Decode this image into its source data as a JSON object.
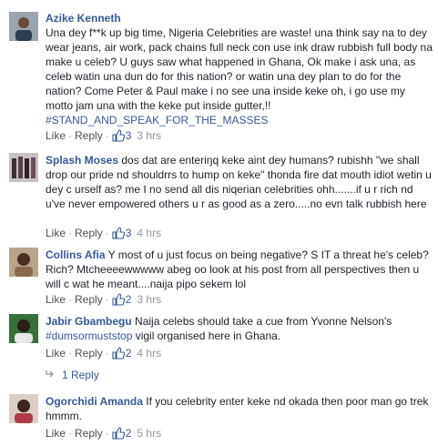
{
  "comments": [
    {
      "author": "Azike Kenneth",
      "text": "Una dey f**k up big time, Nigeria Celebrities are waste! una think say na to dey wear jeans, air work, pack chains full neck con use ink draw rubbish full body na make u celeb? U guys saw what happened in Ghana, Ok make i ask una, as celeb watin una dun do for this nation? or watin una dey plan to do for the nation? Come Peter & Paul make i no see una inside keke oh, i go use my motto jam una with the keke put inside gutter,!!",
      "hashtag": "#STAND_AND_SPEAK_FOR_THE_MASSES",
      "like": "Like",
      "reply": "Reply",
      "likes": "3",
      "time": "3 hrs"
    },
    {
      "author": "Splash Moses",
      "text": "dos dat are enteriŋq keke aint dey humans? rubishh \"we shall drop our pride nd shouldrrs to hump on keke\" thonda fire dat mouth idiot wetin u dey c urself as? me I no send all dis niqerian celebrities ohh.......if u r rich nd u've never empowered others u r as good as a zero.....no evn talk rubbish here",
      "like": "Like",
      "reply": "Reply",
      "likes": "3",
      "time": "4 hrs"
    },
    {
      "author": "Collins Afia",
      "text": "Y most of u just focus on being negative? S IT a threat he's celeb? Rich? Mtcheeeewwwww abeg oo look at his post from all perspectives then u will c wat he meant....naija pipo sekem lol",
      "like": "Like",
      "reply": "Reply",
      "likes": "2",
      "time": "3 hrs"
    },
    {
      "author": "Jabir Gbambegu",
      "text": "Naija celebs should take a cue from Yvonne Nelson's",
      "hashtag": "#dumsormuststop",
      "text2": "vigil organised here in Ghana.",
      "like": "Like",
      "reply": "Reply",
      "likes": "2",
      "time": "4 hrs",
      "replies": "1 Reply"
    },
    {
      "author": "Ogorchidi Amanda",
      "text": "If you celebrity enter keke nd okada then poor man go trek hmmm.",
      "like": "Like",
      "reply": "Reply",
      "likes": "2",
      "time": "5 hrs"
    }
  ],
  "colors": {
    "link": "#365899",
    "meta": "#90949c",
    "text": "#1d2129"
  }
}
